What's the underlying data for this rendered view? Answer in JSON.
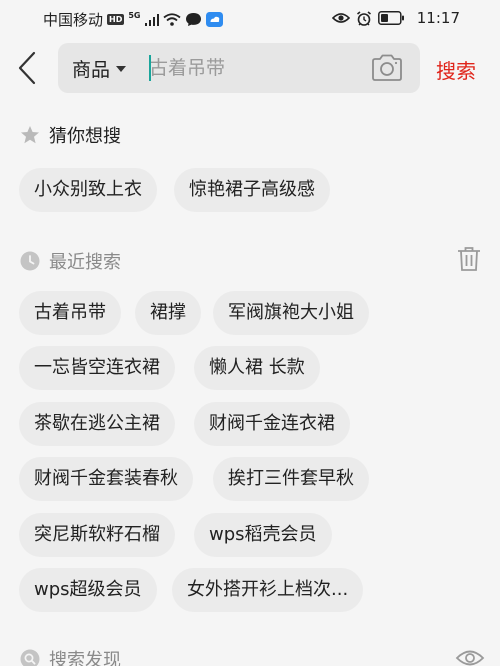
{
  "status_bar": {
    "carrier": "中国移动",
    "hd": "HD",
    "net": "5G",
    "time": "11:17"
  },
  "search": {
    "category": "商品",
    "placeholder": "古着吊带",
    "submit_label": "搜索"
  },
  "guess": {
    "title": "猜你想搜",
    "items": [
      "小众别致上衣",
      "惊艳裙子高级感"
    ]
  },
  "recent": {
    "title": "最近搜索",
    "items": [
      "古着吊带",
      "裙撑",
      "军阀旗袍大小姐",
      "一忘皆空连衣裙",
      "懒人裙 长款",
      "茶歇在逃公主裙",
      "财阀千金连衣裙",
      "财阀千金套装春秋",
      "挨打三件套早秋",
      "突尼斯软籽石榴",
      "wps稻壳会员",
      "wps超级会员",
      "女外搭开衫上档次..."
    ]
  },
  "discover": {
    "title": "搜索发现"
  },
  "colors": {
    "accent": "#e0251b",
    "cursor": "#1aa59b",
    "chip_bg": "#ebebeb",
    "background": "#f5f5f5"
  }
}
